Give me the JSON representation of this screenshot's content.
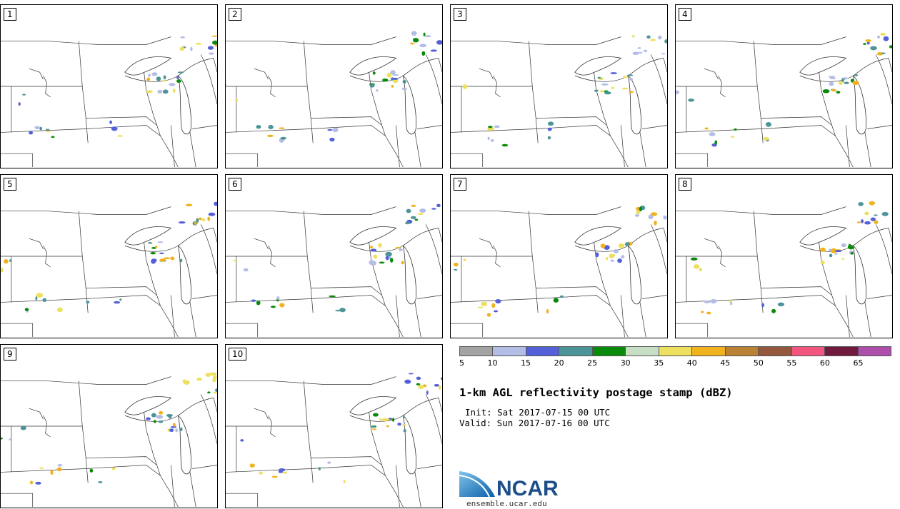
{
  "panels": [
    {
      "label": "1"
    },
    {
      "label": "2"
    },
    {
      "label": "3"
    },
    {
      "label": "4"
    },
    {
      "label": "5"
    },
    {
      "label": "6"
    },
    {
      "label": "7"
    },
    {
      "label": "8"
    },
    {
      "label": "9"
    },
    {
      "label": "10"
    }
  ],
  "colorbar": {
    "colors": [
      "#a3a3a3",
      "#b3bde6",
      "#5460d8",
      "#4d9499",
      "#0a8a0a",
      "#c6dfc4",
      "#ede05e",
      "#f0b21e",
      "#ba8235",
      "#94593d",
      "#f2557f",
      "#6f1a3e",
      "#ad4faa"
    ],
    "ticks": [
      "5",
      "10",
      "15",
      "20",
      "25",
      "30",
      "35",
      "40",
      "45",
      "50",
      "55",
      "60",
      "65"
    ]
  },
  "title": "1-km AGL reflectivity postage stamp (dBZ)",
  "init": "Init: Sat 2017-07-15 00 UTC",
  "valid": "Valid: Sun 2017-07-16 00 UTC",
  "logo": {
    "text": "NCAR"
  },
  "url": "ensemble.ucar.edu"
}
